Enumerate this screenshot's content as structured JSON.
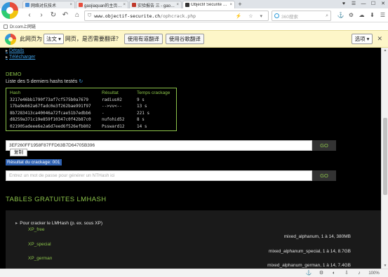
{
  "tabs": [
    {
      "title": "网络对抗技术",
      "icon_color": "#4a90d9",
      "active": false
    },
    {
      "title": "gaojiaquan的主页 - 博客",
      "icon_color": "#e74c3c",
      "active": false
    },
    {
      "title": "实验报告 三 - gaojiaquan",
      "icon_color": "#c0392b",
      "active": false
    },
    {
      "title": "Objectif Sécurité - Opht",
      "icon_color": "#333333",
      "active": true
    }
  ],
  "tab_new": "+",
  "window_controls": [
    "♥",
    "☰",
    "—",
    "☐",
    "✕"
  ],
  "nav": {
    "back": "‹",
    "forward": "›",
    "reload": "↻",
    "undo": "↶",
    "home": "⌂"
  },
  "url": {
    "host": "www.objectif-securite.ch",
    "path": "/ophcrack.php",
    "icons": "⚡ ☆ ▾"
  },
  "search": {
    "placeholder": "360搜索",
    "icon": "⌕"
  },
  "toolbar_icons": [
    "⚓",
    "⚙",
    "☁",
    "⬇",
    "☰"
  ],
  "bookmarks": [
    {
      "label": "Dr.com上网链"
    }
  ],
  "translate_bar": {
    "prefix": "此网页为",
    "language": "法文",
    "question": "网页，是否需要翻译？",
    "btn_youdao": "使用有道翻译",
    "btn_google": "使用谷歌翻译",
    "options": "选项",
    "close": "✕"
  },
  "page": {
    "links": [
      "Détails",
      "Télécharger"
    ],
    "demo_title": "DEMO",
    "recent_label": "Liste des 5 derniers hashs testés",
    "refresh_icon": "↻",
    "table": {
      "headers": [
        "Hash",
        "Résultat",
        "Temps crackage"
      ],
      "rows": [
        [
          "3217e46bb1790f73af7cf575b0a7679",
          "radius02",
          "9 s"
        ],
        [
          "17ba9e662a67fadc0e3f262bae991f97",
          "-->vv<--",
          "13 s"
        ],
        [
          "8b7283413ca40046a72fcae51b7edbb6",
          "-",
          "221 s"
        ],
        [
          "d8259a371c19e859f10347c0f42b87c0",
          "nufohid52",
          "8 s"
        ],
        [
          "021905adeee6e2a6d7eed6f526efb802",
          "Pssward12",
          "14 s"
        ]
      ]
    },
    "hash_value": "3EF260FF1958F87FFD63B7D64705B396",
    "go_label": "GO",
    "copy_label": "复制",
    "result_text": "Résultat du crackage: 001",
    "nt_placeholder": "Entrez un mot de passe pour générer un NTHash ici",
    "lm_title": "TABLES GRATUITES LMHASH",
    "lm_tip": "Pour cracker le LMHash (p. ex. sous XP)",
    "tables": [
      {
        "name": "XP_free",
        "info": "mixed_alphanum, 1 à 14, 380MB"
      },
      {
        "name": "XP_special",
        "info": "mixed_alphanum_special, 1 à 14, 8.7GB"
      },
      {
        "name": "XP_german",
        "info": "mixed_alphanum_german, 1 à 14, 7.4GB"
      }
    ]
  },
  "status": {
    "icons": [
      "⚓",
      "⚙",
      "◐",
      "⇩",
      "♪"
    ],
    "zoom": "100%"
  }
}
